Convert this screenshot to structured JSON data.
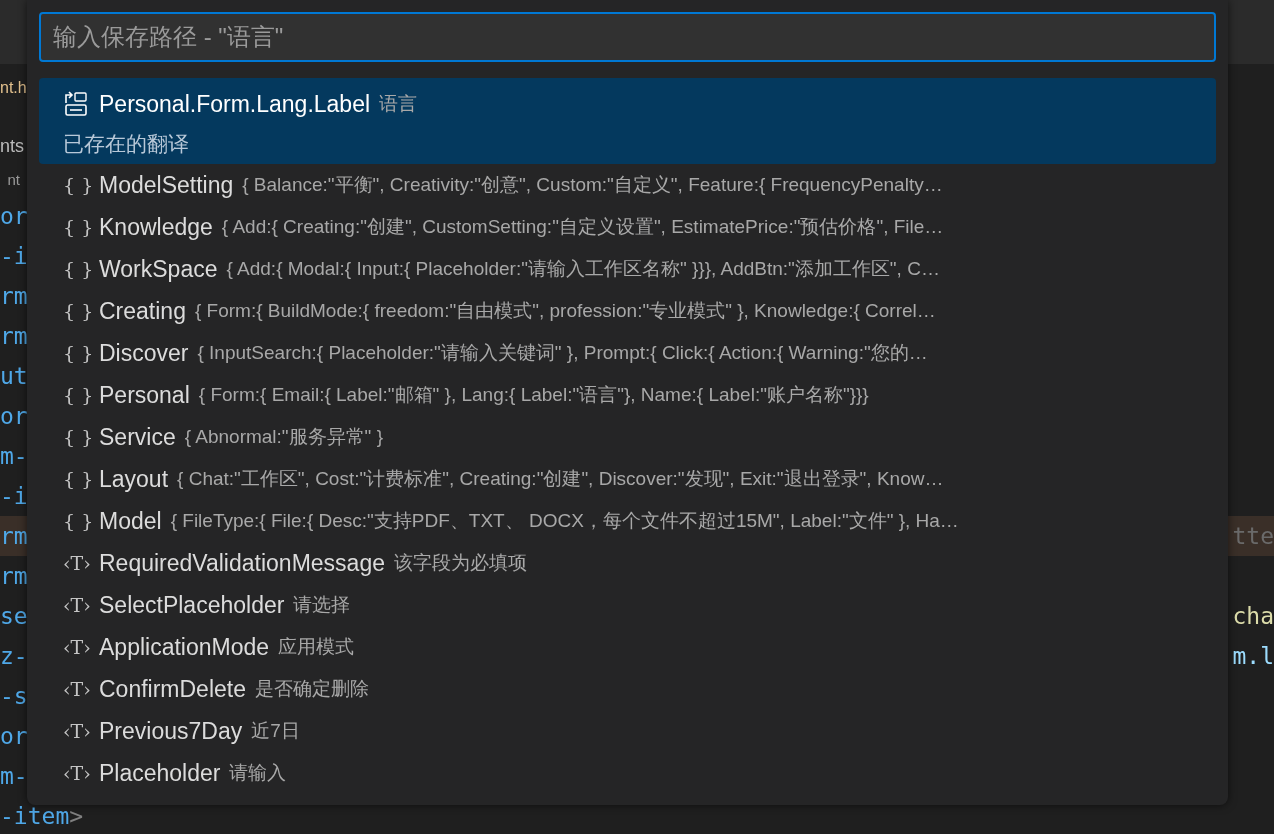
{
  "editor": {
    "tab": "nt.h",
    "outline_title": "nts",
    "outline_subtitle": "nt",
    "lines": [
      {
        "tokens": [
          {
            "text": "or",
            "kind": "tag"
          }
        ]
      },
      {
        "tokens": [
          {
            "text": "-i",
            "kind": "tag"
          }
        ]
      },
      {
        "tokens": [
          {
            "text": "rm",
            "kind": "tag"
          }
        ]
      },
      {
        "tokens": [
          {
            "text": "rm",
            "kind": "tag"
          }
        ]
      },
      {
        "tokens": [
          {
            "text": "ut",
            "kind": "tag"
          }
        ]
      },
      {
        "tokens": [
          {
            "text": "or",
            "kind": "tag"
          }
        ]
      },
      {
        "tokens": [
          {
            "text": "m-",
            "kind": "tag"
          }
        ]
      },
      {
        "tokens": [
          {
            "text": "-i",
            "kind": "tag"
          }
        ]
      },
      {
        "tokens": [
          {
            "text": "rm",
            "kind": "tag"
          }
        ],
        "highlighted": true,
        "right": {
          "text": "tte",
          "kind": "plain"
        }
      },
      {
        "tokens": [
          {
            "text": "rm",
            "kind": "tag"
          }
        ]
      },
      {
        "tokens": [
          {
            "text": "se",
            "kind": "tag"
          }
        ],
        "right": {
          "text": "cha",
          "kind": "function"
        }
      },
      {
        "tokens": [
          {
            "text": "z-",
            "kind": "tag"
          }
        ],
        "right": {
          "text": "m.l",
          "kind": "variable"
        }
      },
      {
        "tokens": [
          {
            "text": "-s",
            "kind": "tag"
          }
        ]
      },
      {
        "tokens": [
          {
            "text": "or",
            "kind": "tag"
          }
        ]
      },
      {
        "tokens": [
          {
            "text": "m-",
            "kind": "tag"
          }
        ]
      },
      {
        "tokens": [
          {
            "text": "-item",
            "kind": "tag"
          },
          {
            "text": ">",
            "kind": "punct"
          }
        ]
      }
    ]
  },
  "quick_pick": {
    "placeholder": "输入保存路径 - \"语言\"",
    "items": [
      {
        "kind": "translation",
        "label": "Personal.Form.Lang.Label",
        "description": "语言",
        "detail": "已存在的翻译",
        "selected": true
      },
      {
        "kind": "object",
        "icon": "{ }",
        "label": "ModelSetting",
        "description": "{ Balance:\"平衡\", Creativity:\"创意\", Custom:\"自定义\", Feature:{ FrequencyPenalty…",
        "selected": false
      },
      {
        "kind": "object",
        "icon": "{ }",
        "label": "Knowledge",
        "description": "{ Add:{ Creating:\"创建\", CustomSetting:\"自定义设置\", EstimatePrice:\"预估价格\", File…",
        "selected": false
      },
      {
        "kind": "object",
        "icon": "{ }",
        "label": "WorkSpace",
        "description": "{ Add:{ Modal:{ Input:{ Placeholder:\"请输入工作区名称\" }}}, AddBtn:\"添加工作区\", C…",
        "selected": false
      },
      {
        "kind": "object",
        "icon": "{ }",
        "label": "Creating",
        "description": "{ Form:{ BuildMode:{ freedom:\"自由模式\", profession:\"专业模式\" }, Knowledge:{ Correl…",
        "selected": false
      },
      {
        "kind": "object",
        "icon": "{ }",
        "label": "Discover",
        "description": "{ InputSearch:{ Placeholder:\"请输入关键词\" }, Prompt:{ Click:{ Action:{ Warning:\"您的…",
        "selected": false
      },
      {
        "kind": "object",
        "icon": "{ }",
        "label": "Personal",
        "description": "{ Form:{ Email:{ Label:\"邮箱\" }, Lang:{ Label:\"语言\"}, Name:{ Label:\"账户名称\"}}}",
        "selected": false
      },
      {
        "kind": "object",
        "icon": "{ }",
        "label": "Service",
        "description": "{ Abnormal:\"服务异常\" }",
        "selected": false
      },
      {
        "kind": "object",
        "icon": "{ }",
        "label": "Layout",
        "description": "{ Chat:\"工作区\", Cost:\"计费标准\", Creating:\"创建\", Discover:\"发现\", Exit:\"退出登录\", Know…",
        "selected": false
      },
      {
        "kind": "object",
        "icon": "{ }",
        "label": "Model",
        "description": "{ FileType:{ File:{ Desc:\"支持PDF、TXT、 DOCX，每个文件不超过15M\", Label:\"文件\" }, Ha…",
        "selected": false
      },
      {
        "kind": "string",
        "icon": "‹T›",
        "label": "RequiredValidationMessage",
        "description": "该字段为必填项",
        "selected": false
      },
      {
        "kind": "string",
        "icon": "‹T›",
        "label": "SelectPlaceholder",
        "description": "请选择",
        "selected": false
      },
      {
        "kind": "string",
        "icon": "‹T›",
        "label": "ApplicationMode",
        "description": "应用模式",
        "selected": false
      },
      {
        "kind": "string",
        "icon": "‹T›",
        "label": "ConfirmDelete",
        "description": "是否确定删除",
        "selected": false
      },
      {
        "kind": "string",
        "icon": "‹T›",
        "label": "Previous7Day",
        "description": "近7日",
        "selected": false
      },
      {
        "kind": "string",
        "icon": "‹T›",
        "label": "Placeholder",
        "description": "请输入",
        "selected": false
      }
    ]
  }
}
